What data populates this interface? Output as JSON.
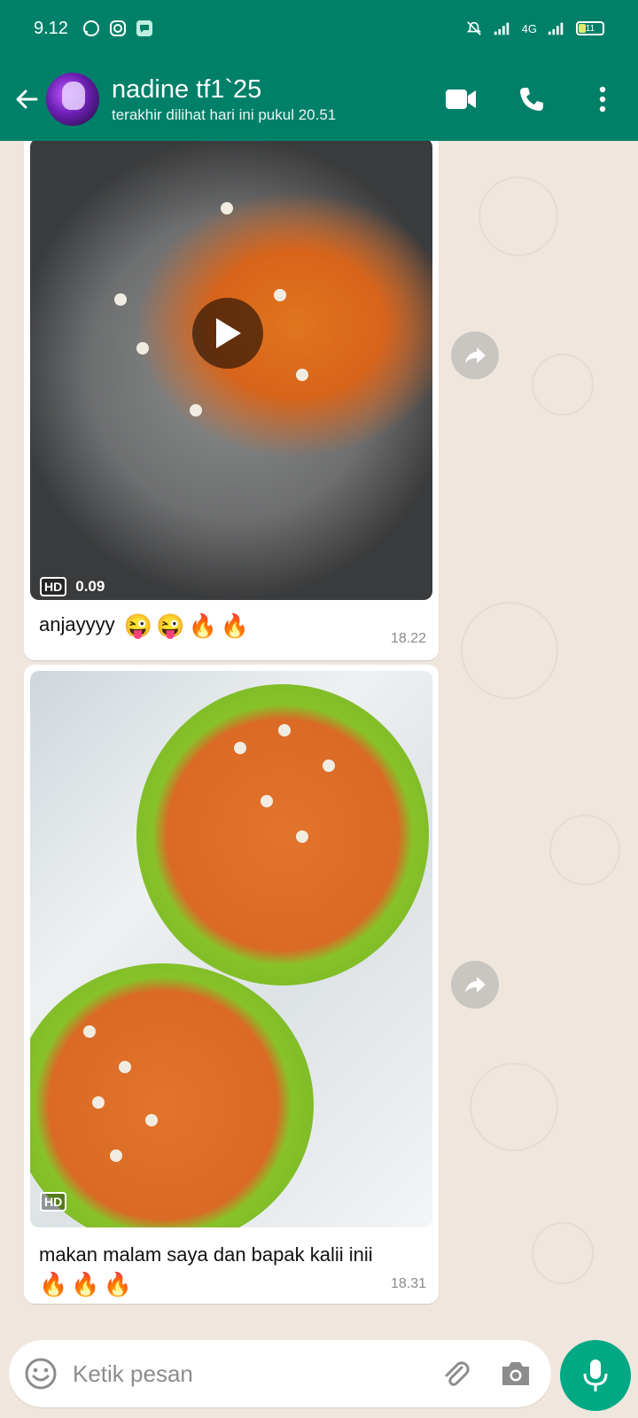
{
  "status_bar": {
    "time": "9.12",
    "network": "4G",
    "battery_percent": "11",
    "icons": [
      "whatsapp-icon",
      "instagram-icon",
      "message-app-icon",
      "mute-icon",
      "signal-icon",
      "signal-4g-icon",
      "battery-icon"
    ]
  },
  "header": {
    "contact_name": "nadine tf1`25",
    "last_seen": "terakhir dilihat hari ini pukul 20.51",
    "actions": [
      "video-call-icon",
      "voice-call-icon",
      "more-options-icon"
    ]
  },
  "messages": [
    {
      "type": "video",
      "hd_label": "HD",
      "duration": "0.09",
      "caption": "anjayyyy",
      "caption_emojis": [
        "😜",
        "😜",
        "🔥",
        "🔥"
      ],
      "time": "18.22"
    },
    {
      "type": "image",
      "hd_label": "HD",
      "caption": "makan malam saya dan bapak kalii inii",
      "caption_emojis": [
        "🔥",
        "🔥",
        "🔥"
      ],
      "time": "18.31"
    }
  ],
  "composer": {
    "placeholder": "Ketik pesan"
  },
  "colors": {
    "header_bg": "#008069",
    "chat_bg": "#efe7de",
    "mic_bg": "#00a884"
  }
}
